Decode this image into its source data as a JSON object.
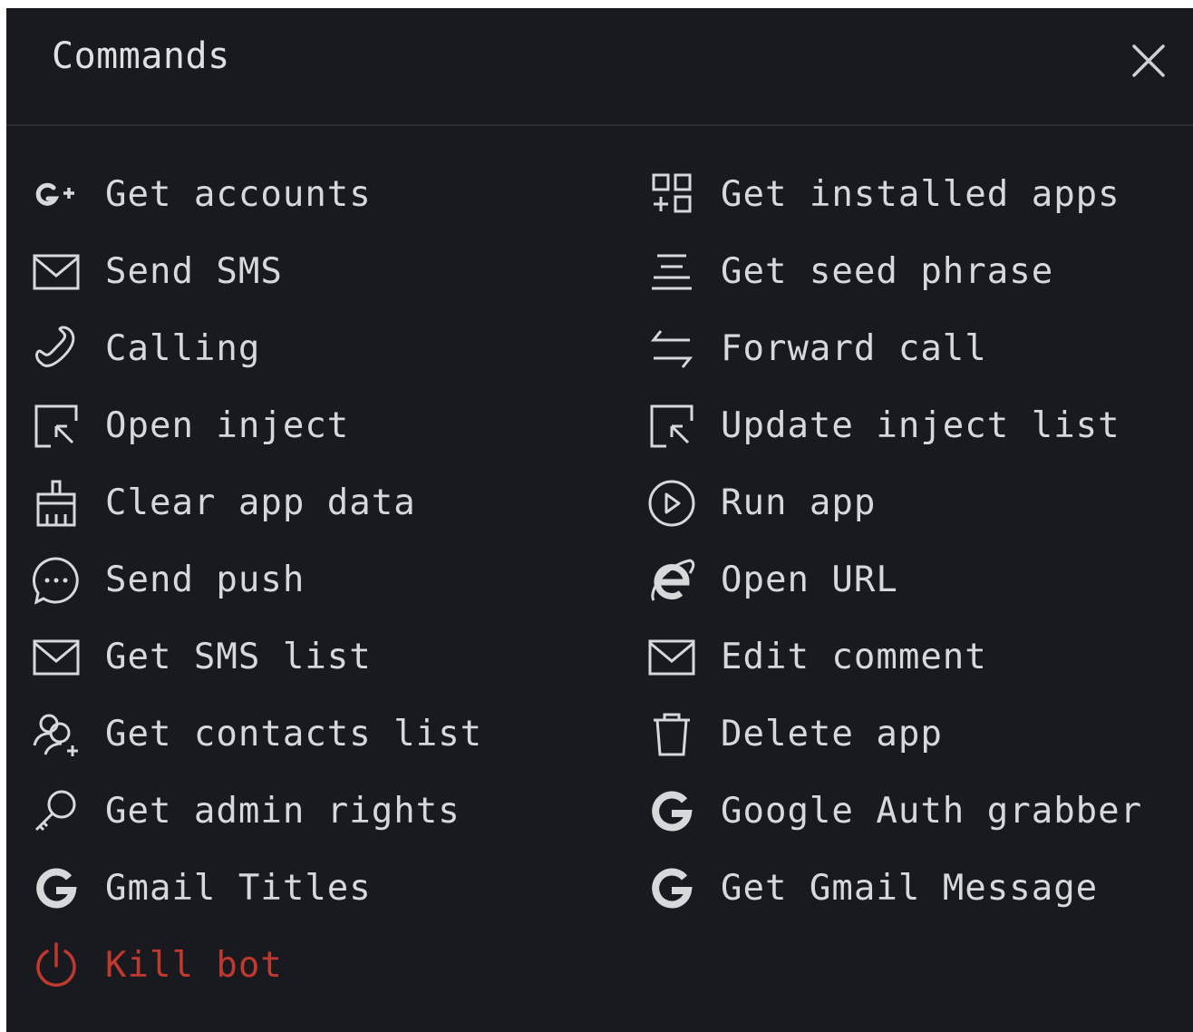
{
  "dialog": {
    "title": "Commands",
    "close_label": "X"
  },
  "colors": {
    "background": "#181a1f",
    "text": "#d7d8da",
    "danger": "#c0392f"
  },
  "commands_left": [
    {
      "label": "Get accounts",
      "icon": "google-plus-icon"
    },
    {
      "label": "Send SMS",
      "icon": "envelope-icon"
    },
    {
      "label": "Calling",
      "icon": "phone-icon"
    },
    {
      "label": "Open inject",
      "icon": "cursor-box-icon"
    },
    {
      "label": "Clear app data",
      "icon": "broom-icon"
    },
    {
      "label": "Send push",
      "icon": "chat-bubble-icon"
    },
    {
      "label": "Get SMS list",
      "icon": "envelope-icon"
    },
    {
      "label": "Get contacts list",
      "icon": "contacts-icon"
    },
    {
      "label": "Get admin rights",
      "icon": "key-icon"
    },
    {
      "label": "Gmail Titles",
      "icon": "google-icon"
    },
    {
      "label": "Kill bot",
      "icon": "power-icon"
    }
  ],
  "commands_right": [
    {
      "label": "Get installed apps",
      "icon": "apps-grid-icon"
    },
    {
      "label": "Get seed phrase",
      "icon": "align-center-icon"
    },
    {
      "label": "Forward call",
      "icon": "swap-arrows-icon"
    },
    {
      "label": "Update inject list",
      "icon": "cursor-box-icon"
    },
    {
      "label": "Run app",
      "icon": "play-circle-icon"
    },
    {
      "label": "Open URL",
      "icon": "internet-explorer-icon"
    },
    {
      "label": "Edit comment",
      "icon": "envelope-icon"
    },
    {
      "label": "Delete app",
      "icon": "trash-icon"
    },
    {
      "label": "Google Auth grabber",
      "icon": "google-icon"
    },
    {
      "label": "Get Gmail Message",
      "icon": "google-icon"
    }
  ]
}
